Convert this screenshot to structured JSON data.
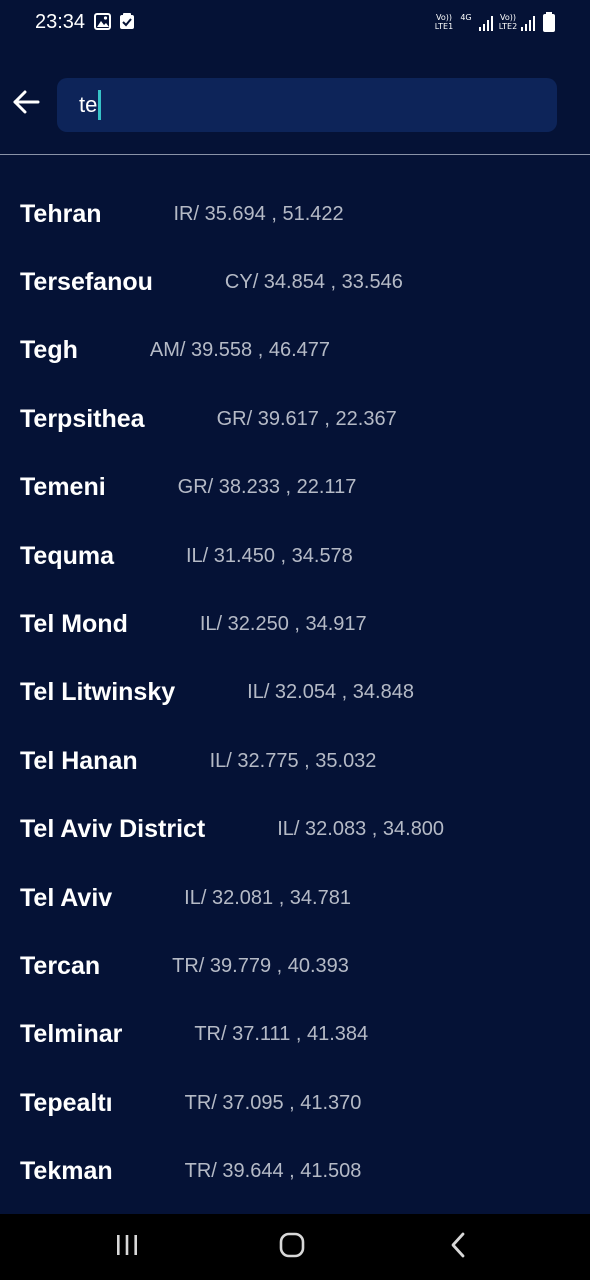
{
  "status_bar": {
    "time": "23:34",
    "sim1_label": "Vo)) LTE1",
    "network_type": "4G",
    "sim2_label": "Vo)) LTE2"
  },
  "search": {
    "query": "te"
  },
  "results": [
    {
      "city": "Tehran",
      "coords": "IR/ 35.694 , 51.422"
    },
    {
      "city": "Tersefanou",
      "coords": "CY/ 34.854 , 33.546"
    },
    {
      "city": "Tegh",
      "coords": "AM/ 39.558 , 46.477"
    },
    {
      "city": "Terpsithea",
      "coords": "GR/ 39.617 , 22.367"
    },
    {
      "city": "Temeni",
      "coords": "GR/ 38.233 , 22.117"
    },
    {
      "city": "Tequma",
      "coords": "IL/ 31.450 , 34.578"
    },
    {
      "city": "Tel Mond",
      "coords": "IL/ 32.250 , 34.917"
    },
    {
      "city": "Tel Litwinsky",
      "coords": "IL/ 32.054 , 34.848"
    },
    {
      "city": "Tel Hanan",
      "coords": "IL/ 32.775 , 35.032"
    },
    {
      "city": "Tel Aviv District",
      "coords": "IL/ 32.083 , 34.800"
    },
    {
      "city": "Tel Aviv",
      "coords": "IL/ 32.081 , 34.781"
    },
    {
      "city": "Tercan",
      "coords": "TR/ 39.779 , 40.393"
    },
    {
      "city": "Telminar",
      "coords": "TR/ 37.111 , 41.384"
    },
    {
      "city": "Tepealtı",
      "coords": "TR/ 37.095 , 41.370"
    },
    {
      "city": "Tekman",
      "coords": "TR/ 39.644 , 41.508"
    }
  ],
  "colors": {
    "background": "#051236",
    "search_box": "#0d2459",
    "caret": "#37c3c8",
    "coords_text": "#b5bac6"
  },
  "icons": {
    "back": "arrow-left-icon",
    "recent_apps": "recent-apps-icon",
    "home": "home-icon",
    "nav_back": "chevron-left-icon"
  }
}
